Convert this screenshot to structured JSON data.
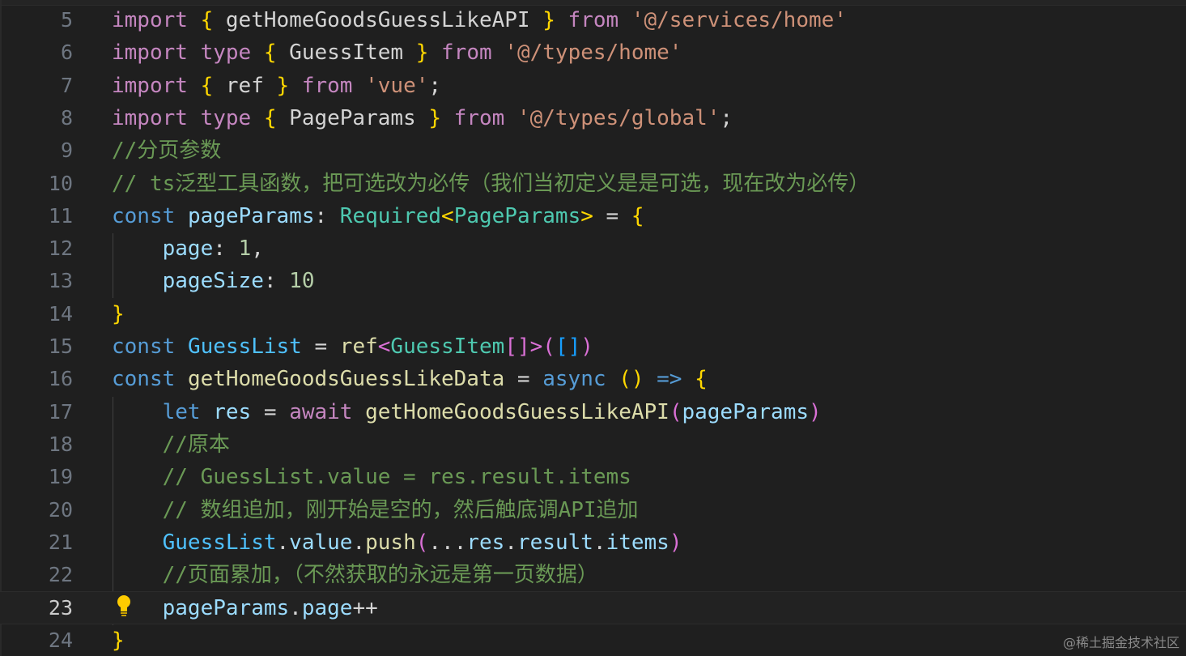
{
  "editor": {
    "current_line": "23",
    "watermark": "@稀土掘金技术社区",
    "lines": [
      {
        "n": "5",
        "t": [
          "import",
          " ",
          "{",
          " getHomeGoodsGuessLikeAPI ",
          "}",
          " ",
          "from",
          " ",
          "'@/services/home'"
        ]
      },
      {
        "n": "6",
        "t": [
          "import",
          " ",
          "type",
          " ",
          "{",
          " GuessItem ",
          "}",
          " ",
          "from",
          " ",
          "'@/types/home'"
        ]
      },
      {
        "n": "7",
        "t": [
          "import",
          " ",
          "{",
          " ref ",
          "}",
          " ",
          "from",
          " ",
          "'vue'",
          ";"
        ]
      },
      {
        "n": "8",
        "t": [
          "import",
          " ",
          "type",
          " ",
          "{",
          " PageParams ",
          "}",
          " ",
          "from",
          " ",
          "'@/types/global'",
          ";"
        ]
      },
      {
        "n": "9",
        "t": [
          "//分页参数"
        ]
      },
      {
        "n": "10",
        "t": [
          "// ts泛型工具函数，把可选改为必传（我们当初定义是是可选，现在改为必传）"
        ]
      },
      {
        "n": "11",
        "t": [
          "const",
          " ",
          "pageParams",
          ": ",
          "Required",
          "<",
          "PageParams",
          ">",
          " = ",
          "{"
        ]
      },
      {
        "n": "12",
        "t": [
          "    ",
          "page",
          ": ",
          "1",
          ","
        ]
      },
      {
        "n": "13",
        "t": [
          "    ",
          "pageSize",
          ": ",
          "10"
        ]
      },
      {
        "n": "14",
        "t": [
          "}"
        ]
      },
      {
        "n": "15",
        "t": [
          "const",
          " ",
          "GuessList",
          " = ",
          "ref",
          "<",
          "GuessItem",
          "[]",
          ">",
          "(",
          "[]",
          ")"
        ]
      },
      {
        "n": "16",
        "t": [
          "const",
          " ",
          "getHomeGoodsGuessLikeData",
          " = ",
          "async",
          " ",
          "()",
          " ",
          "=>",
          " ",
          "{"
        ]
      },
      {
        "n": "17",
        "t": [
          "    ",
          "let",
          " ",
          "res",
          " = ",
          "await",
          " ",
          "getHomeGoodsGuessLikeAPI",
          "(",
          "pageParams",
          ")"
        ]
      },
      {
        "n": "18",
        "t": [
          "    ",
          "//原本"
        ]
      },
      {
        "n": "19",
        "t": [
          "    ",
          "// GuessList.value = res.result.items"
        ]
      },
      {
        "n": "20",
        "t": [
          "    ",
          "// 数组追加，刚开始是空的，然后触底调API追加"
        ]
      },
      {
        "n": "21",
        "t": [
          "    ",
          "GuessList",
          ".",
          "value",
          ".",
          "push",
          "(",
          "...",
          "res",
          ".",
          "result",
          ".",
          "items",
          ")"
        ]
      },
      {
        "n": "22",
        "t": [
          "    ",
          "//页面累加，（不然获取的永远是第一页数据）"
        ]
      },
      {
        "n": "23",
        "t": [
          "    ",
          "pageParams",
          ".",
          "page",
          "++"
        ]
      },
      {
        "n": "24",
        "t": [
          "}"
        ]
      }
    ]
  }
}
